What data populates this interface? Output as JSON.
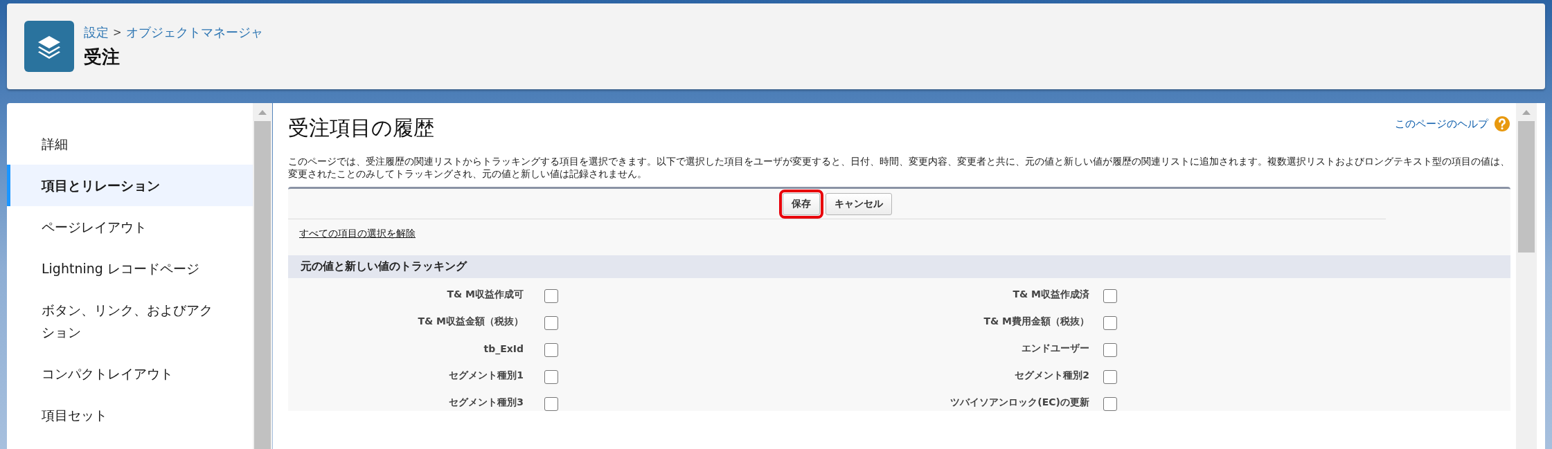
{
  "header": {
    "breadcrumb": [
      {
        "label": "設定"
      },
      {
        "label": "オブジェクトマネージャ"
      }
    ],
    "separator": ">",
    "title": "受注"
  },
  "sidebar": {
    "items": [
      {
        "label": "詳細",
        "selected": false
      },
      {
        "label": "項目とリレーション",
        "selected": true
      },
      {
        "label": "ページレイアウト",
        "selected": false
      },
      {
        "label": "Lightning レコードページ",
        "selected": false
      },
      {
        "label": "ボタン、リンク、およびアクション",
        "selected": false
      },
      {
        "label": "コンパクトレイアウト",
        "selected": false
      },
      {
        "label": "項目セット",
        "selected": false
      }
    ]
  },
  "main": {
    "title": "受注項目の履歴",
    "help_link": "このページのヘルプ",
    "description": "このページでは、受注履歴の関連リストからトラッキングする項目を選択できます。以下で選択した項目をユーザが変更すると、日付、時間、変更内容、変更者と共に、元の値と新しい値が履歴の関連リストに追加されます。複数選択リストおよびロングテキスト型の項目の値は、変更されたことのみしてトラッキングされ、元の値と新しい値は記録されません。",
    "buttons": [
      {
        "label": "保存",
        "highlighted": true
      },
      {
        "label": "キャンセル",
        "highlighted": false
      }
    ],
    "deselect_link": "すべての項目の選択を解除",
    "section": {
      "title": "元の値と新しい値のトラッキング",
      "fields": [
        {
          "label": "T& M収益作成可",
          "checked": false
        },
        {
          "label": "T& M収益作成済",
          "checked": false
        },
        {
          "label": "T& M収益金額（税抜）",
          "checked": false
        },
        {
          "label": "T& M費用金額（税抜）",
          "checked": false
        },
        {
          "label": "tb_ExId",
          "checked": false
        },
        {
          "label": "エンドユーザー",
          "checked": false
        },
        {
          "label": "セグメント種別1",
          "checked": false
        },
        {
          "label": "セグメント種別2",
          "checked": false
        },
        {
          "label": "セグメント種別3",
          "checked": false
        },
        {
          "label": "ツバイソアンロック(EC)の更新",
          "checked": false
        }
      ]
    }
  }
}
